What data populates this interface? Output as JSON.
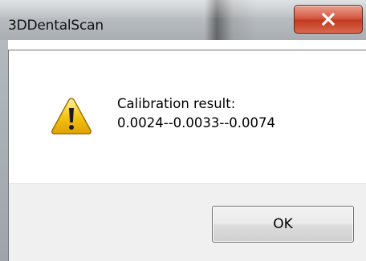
{
  "window": {
    "title": "3DDentalScan"
  },
  "message": {
    "line1": "Calibration result:",
    "line2": "0.0024--0.0033--0.0074"
  },
  "buttons": {
    "ok_label": "OK"
  },
  "icons": {
    "message_icon": "warning-icon",
    "close_icon": "close-icon"
  },
  "colors": {
    "close_button": "#c4391f",
    "warning_fill": "#f5c518",
    "footer_bg": "#f0f0f0"
  }
}
